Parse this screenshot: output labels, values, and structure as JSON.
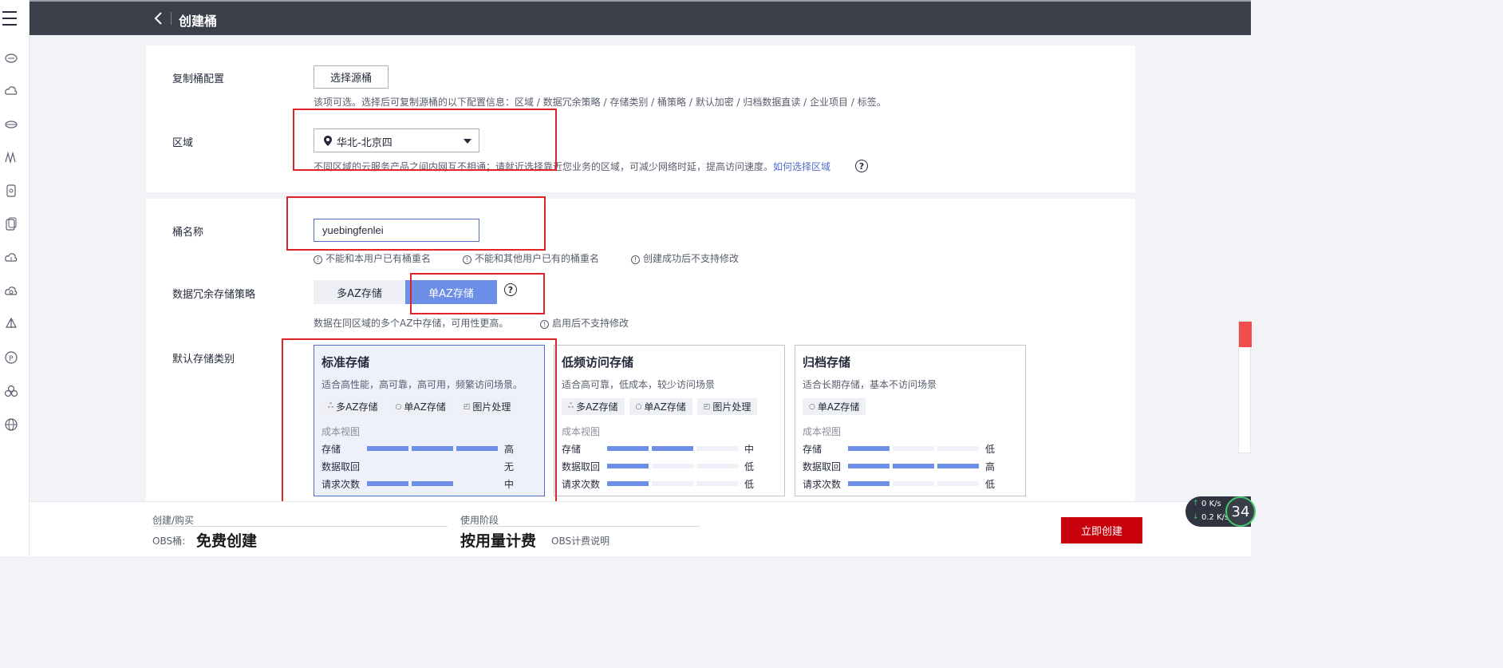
{
  "header": {
    "title": "创建桶"
  },
  "replicate": {
    "label": "复制桶配置",
    "button": "选择源桶",
    "hint": "该项可选。选择后可复制源桶的以下配置信息：区域 / 数据冗余策略 / 存储类别 / 桶策略 / 默认加密 / 归档数据直读 / 企业项目 / 标签。"
  },
  "region": {
    "label": "区域",
    "value": "华北-北京四",
    "hint": "不同区域的云服务产品之间内网互不相通；请就近选择靠近您业务的区域，可减少网络时延，提高访问速度。",
    "link": "如何选择区域"
  },
  "bucket_name": {
    "label": "桶名称",
    "value": "yuebingfenlei",
    "rules": [
      "不能和本用户已有桶重名",
      "不能和其他用户已有的桶重名",
      "创建成功后不支持修改"
    ]
  },
  "redundancy": {
    "label": "数据冗余存储策略",
    "options": [
      "多AZ存储",
      "单AZ存储"
    ],
    "selected": "单AZ存储",
    "hint": "数据在同区域的多个AZ中存储，可用性更高。",
    "warn": "启用后不支持修改"
  },
  "storage_class": {
    "label": "默认存储类别",
    "cost_view_label": "成本视图",
    "accent": "#6d8ee6",
    "cards": [
      {
        "title": "标准存储",
        "desc": "适合高性能，高可靠，高可用，频繁访问场景。",
        "selected": true,
        "tags": [
          "多AZ存储",
          "单AZ存储",
          "图片处理"
        ],
        "metrics": [
          {
            "name": "存储",
            "level": 3,
            "text": "高"
          },
          {
            "name": "数据取回",
            "level": 0,
            "text": "无"
          },
          {
            "name": "请求次数",
            "level": 2,
            "text": "中"
          }
        ]
      },
      {
        "title": "低频访问存储",
        "desc": "适合高可靠，低成本，较少访问场景",
        "selected": false,
        "tags": [
          "多AZ存储",
          "单AZ存储",
          "图片处理"
        ],
        "metrics": [
          {
            "name": "存储",
            "level": 2,
            "text": "中"
          },
          {
            "name": "数据取回",
            "level": 1,
            "text": "低"
          },
          {
            "name": "请求次数",
            "level": 1,
            "text": "低"
          }
        ]
      },
      {
        "title": "归档存储",
        "desc": "适合长期存储，基本不访问场景",
        "selected": false,
        "tags": [
          "单AZ存储"
        ],
        "metrics": [
          {
            "name": "存储",
            "level": 1,
            "text": "低"
          },
          {
            "name": "数据取回",
            "level": 3,
            "text": "高"
          },
          {
            "name": "请求次数",
            "level": 1,
            "text": "低"
          }
        ]
      }
    ]
  },
  "footer": {
    "purchase_label": "创建/购买",
    "obs_label": "OBS桶:",
    "obs_value": "免费创建",
    "usage_label": "使用阶段",
    "usage_value": "按用量计费",
    "billing_link": "OBS计费说明",
    "create_button": "立即创建"
  },
  "speed": {
    "up_value": "0",
    "up_unit": "K/s",
    "down_value": "0.2",
    "down_unit": "K/s",
    "percent": "34"
  },
  "sidebar_icons": [
    "cloud-server-icon",
    "cloud-icon",
    "storage-icon",
    "network-icon",
    "database-icon",
    "database-copy-icon",
    "cloud-upload-icon",
    "cloud-sync-icon",
    "sail-icon",
    "parking-icon",
    "cluster-icon",
    "globe-icon"
  ]
}
